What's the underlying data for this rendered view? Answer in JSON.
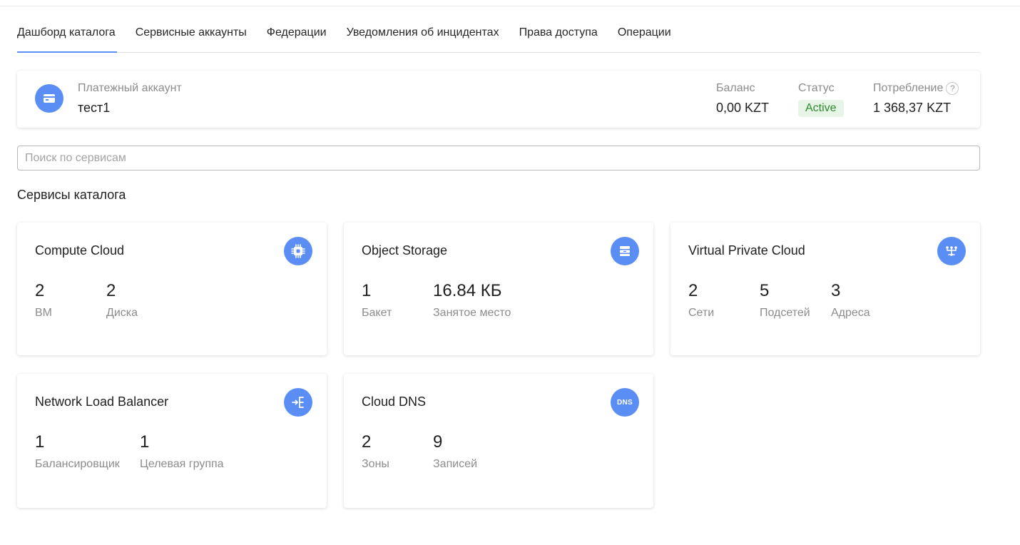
{
  "tabs": [
    {
      "label": "Дашборд каталога",
      "active": true
    },
    {
      "label": "Сервисные аккаунты"
    },
    {
      "label": "Федерации"
    },
    {
      "label": "Уведомления об инцидентах"
    },
    {
      "label": "Права доступа"
    },
    {
      "label": "Операции"
    }
  ],
  "billing": {
    "label": "Платежный аккаунт",
    "name": "тест1",
    "icon": "credit-card-icon",
    "balance_label": "Баланс",
    "balance_value": "0,00 KZT",
    "status_label": "Статус",
    "status_value": "Active",
    "consumption_label": "Потребление",
    "consumption_value": "1 368,37 KZT",
    "help_glyph": "?"
  },
  "search": {
    "placeholder": "Поиск по сервисам"
  },
  "section_title": "Сервисы каталога",
  "colors": {
    "accent": "#5b8ef5",
    "status_bg": "#e6f5e6",
    "status_text": "#2e8b2e"
  },
  "services": [
    {
      "title": "Compute Cloud",
      "icon": "chip-icon",
      "metrics": [
        {
          "value": "2",
          "label": "ВМ"
        },
        {
          "value": "2",
          "label": "Диска"
        }
      ]
    },
    {
      "title": "Object Storage",
      "icon": "storage-box-icon",
      "metrics": [
        {
          "value": "1",
          "label": "Бакет"
        },
        {
          "value": "16.84 КБ",
          "label": "Занятое место"
        }
      ]
    },
    {
      "title": "Virtual Private Cloud",
      "icon": "network-icon",
      "metrics": [
        {
          "value": "2",
          "label": "Сети"
        },
        {
          "value": "5",
          "label": "Подсетей"
        },
        {
          "value": "3",
          "label": "Адреса"
        }
      ]
    },
    {
      "title": "Network Load Balancer",
      "icon": "balancer-icon",
      "metrics": [
        {
          "value": "1",
          "label": "Балансировщик"
        },
        {
          "value": "1",
          "label": "Целевая группа"
        }
      ]
    },
    {
      "title": "Cloud DNS",
      "icon": "dns-icon",
      "icon_text": "DNS",
      "metrics": [
        {
          "value": "2",
          "label": "Зоны"
        },
        {
          "value": "9",
          "label": "Записей"
        }
      ]
    }
  ]
}
